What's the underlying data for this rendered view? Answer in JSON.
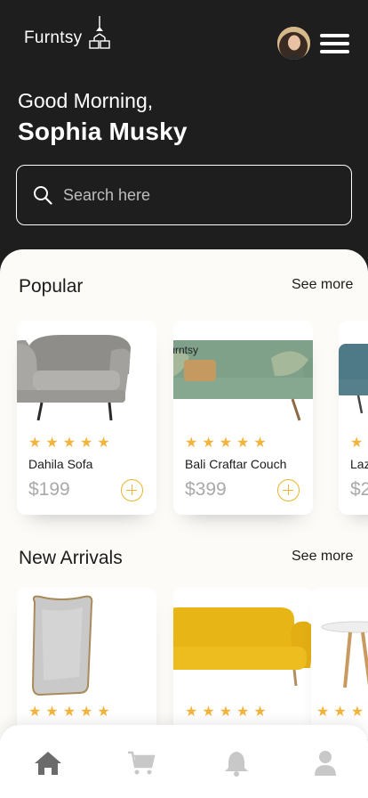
{
  "header": {
    "brand": "Furntsy",
    "greeting": "Good Morning,",
    "user_name": "Sophia Musky",
    "search_placeholder": "Search here"
  },
  "icons": {
    "brand_lamp": "lamp-icon",
    "menu": "menu-icon",
    "search": "search-icon",
    "add": "plus-circle-icon",
    "star": "star-icon"
  },
  "colors": {
    "header_bg": "#1e1e1e",
    "sheet_bg": "#fcfbf8",
    "star": "#f4b33d",
    "accent": "#e9b52a",
    "price": "#a9a9a9",
    "nav_active": "#6b6b6b",
    "nav_inactive": "#c8c8c8"
  },
  "popular": {
    "title": "Popular",
    "see_more": "See more",
    "products": [
      {
        "name": "Dahila Sofa",
        "price": "$199",
        "rating": 5
      },
      {
        "name": "Bali Craftar Couch",
        "price": "$399",
        "rating": 5,
        "tag": "Furntsy"
      },
      {
        "name": "Laz",
        "price": "$2",
        "rating": 5
      }
    ]
  },
  "new_arrivals": {
    "title": "New Arrivals",
    "see_more": "See more",
    "rating": 5
  },
  "bottom_nav": {
    "items": [
      "home-icon",
      "cart-icon",
      "bell-icon",
      "user-icon"
    ],
    "active": "home-icon"
  }
}
